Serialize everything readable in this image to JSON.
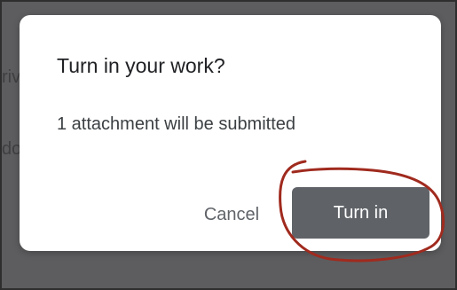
{
  "background": {
    "fragment_1": "rive",
    "fragment_2": "do"
  },
  "dialog": {
    "title": "Turn in your work?",
    "message": "1 attachment will be submitted",
    "cancel_label": "Cancel",
    "confirm_label": "Turn in"
  },
  "colors": {
    "scrim": "#5d5d5f",
    "dialog_background": "#ffffff",
    "primary_button": "#5f6368",
    "annotation": "#a02a1e"
  }
}
